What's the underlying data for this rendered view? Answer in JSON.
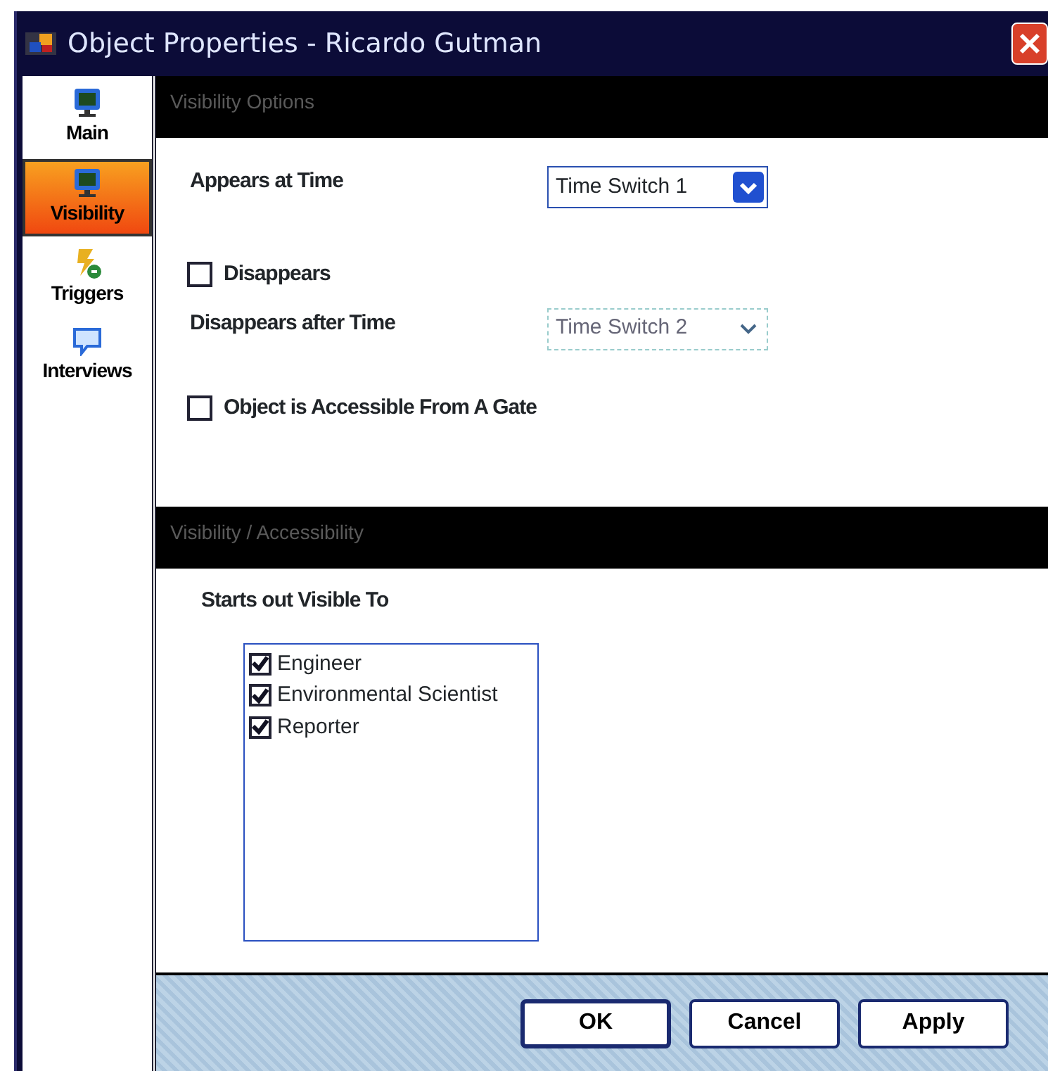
{
  "window": {
    "title": "Object Properties - Ricardo Gutman"
  },
  "sidebar": {
    "items": [
      {
        "label": "Main",
        "kind": "monitor",
        "selected": false
      },
      {
        "label": "Visibility",
        "kind": "monitor",
        "selected": true
      },
      {
        "label": "Triggers",
        "kind": "bolt",
        "selected": false
      },
      {
        "label": "Interviews",
        "kind": "bubble",
        "selected": false
      }
    ]
  },
  "visibility_options": {
    "header": "Visibility Options",
    "appears_at_time": {
      "label": "Appears at Time",
      "value": "Time Switch 1",
      "disabled": false
    },
    "disappears": {
      "label": "Disappears",
      "checked": false
    },
    "disappears_after_time": {
      "label": "Disappears after Time",
      "value": "Time Switch 2",
      "disabled": true
    },
    "accessible_from_gate": {
      "label": "Object is Accessible From A Gate",
      "checked": false
    }
  },
  "visibility_accessibility": {
    "header": "Visibility / Accessibility",
    "label": "Starts out Visible To",
    "roles": [
      {
        "label": "Engineer",
        "checked": true
      },
      {
        "label": "Environmental Scientist",
        "checked": true
      },
      {
        "label": "Reporter",
        "checked": true
      }
    ]
  },
  "buttons": [
    {
      "label": "OK",
      "default": true
    },
    {
      "label": "Cancel",
      "default": false
    },
    {
      "label": "Apply",
      "default": false
    }
  ]
}
